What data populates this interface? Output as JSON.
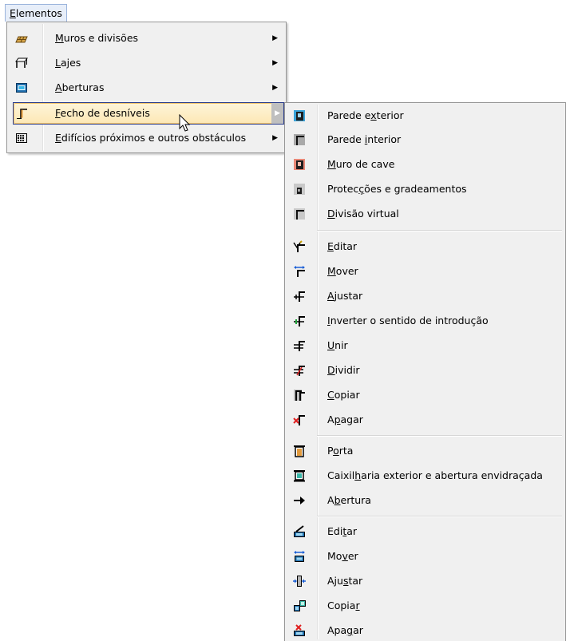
{
  "menubar": {
    "title_ul": "E",
    "title_rest": "lementos"
  },
  "main_menu": {
    "items": [
      {
        "pre": "",
        "ul": "M",
        "post": "uros e divisões"
      },
      {
        "pre": "",
        "ul": "L",
        "post": "ajes"
      },
      {
        "pre": "",
        "ul": "A",
        "post": "berturas"
      },
      {
        "pre": "",
        "ul": "F",
        "post": "echo de desníveis"
      },
      {
        "pre": "",
        "ul": "E",
        "post": "difícios próximos e outros obstáculos"
      }
    ],
    "submenu_arrow": "▶"
  },
  "sub_menu": {
    "group1": [
      {
        "pre": "Parede e",
        "ul": "x",
        "post": "terior"
      },
      {
        "pre": "Parede ",
        "ul": "i",
        "post": "nterior"
      },
      {
        "pre": "",
        "ul": "M",
        "post": "uro de cave"
      },
      {
        "pre": "Protec",
        "ul": "ç",
        "post": "ões e gradeamentos"
      },
      {
        "pre": "",
        "ul": "D",
        "post": "ivisão virtual"
      }
    ],
    "group2": [
      {
        "pre": "",
        "ul": "E",
        "post": "ditar"
      },
      {
        "pre": "",
        "ul": "M",
        "post": "over"
      },
      {
        "pre": "",
        "ul": "A",
        "post": "justar"
      },
      {
        "pre": "",
        "ul": "I",
        "post": "nverter o sentido de introdução"
      },
      {
        "pre": "",
        "ul": "U",
        "post": "nir"
      },
      {
        "pre": "",
        "ul": "D",
        "post": "ividir"
      },
      {
        "pre": "",
        "ul": "C",
        "post": "opiar"
      },
      {
        "pre": "A",
        "ul": "p",
        "post": "agar"
      }
    ],
    "group3": [
      {
        "pre": "P",
        "ul": "o",
        "post": "rta"
      },
      {
        "pre": "Caixil",
        "ul": "h",
        "post": "aria exterior e abertura envidraçada"
      },
      {
        "pre": "A",
        "ul": "b",
        "post": "ertura"
      }
    ],
    "group4": [
      {
        "pre": "Edi",
        "ul": "t",
        "post": "ar"
      },
      {
        "pre": "Mo",
        "ul": "v",
        "post": "er"
      },
      {
        "pre": "Aju",
        "ul": "s",
        "post": "tar"
      },
      {
        "pre": "Copia",
        "ul": "r",
        "post": ""
      },
      {
        "pre": "Apa",
        "ul": "g",
        "post": "ar"
      }
    ]
  },
  "colors": {
    "highlight_bg": "#fde8b6",
    "highlight_border": "#f0c36b",
    "menu_bg": "#f0f0f0"
  }
}
